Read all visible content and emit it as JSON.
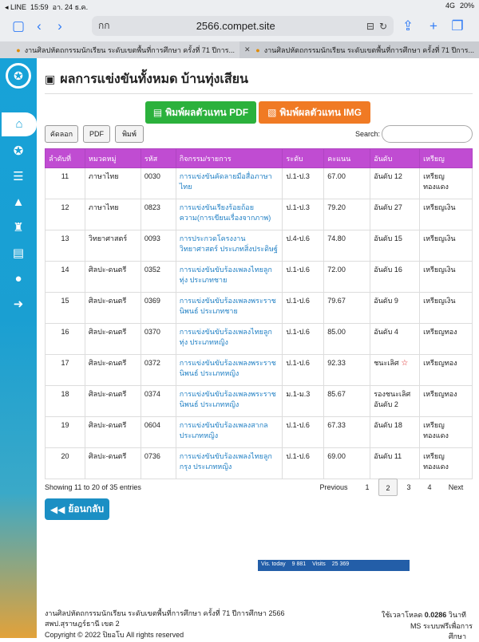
{
  "status": {
    "app": "◂ LINE",
    "time": "15:59",
    "date": "อา. 24 ธ.ค.",
    "net": "4G",
    "battery": "20%"
  },
  "browser": {
    "tabtext": "กก",
    "url": "2566.compet.site",
    "tabs": [
      "งานศิลปหัตถกรรมนักเรียน ระดับเขตพื้นที่การศึกษา ครั้งที่ 71 ปีการ...",
      "งานศิลปหัตถกรรมนักเรียน ระดับเขตพื้นที่การศึกษา ครั้งที่ 71 ปีการ..."
    ]
  },
  "page": {
    "title": "ผลการแข่งขันทั้งหมด บ้านทุ่งเสียน",
    "btn_pdf": "พิมพ์ผลตัวแทน PDF",
    "btn_img": "พิมพ์ผลตัวแทน IMG",
    "btn_copy": "คัดลอก",
    "btn_pdfs": "PDF",
    "btn_print": "พิมพ์",
    "search": "Search:"
  },
  "table": {
    "headers": [
      "ลำดับที่",
      "หมวดหมู่",
      "รหัส",
      "กิจกรรม/รายการ",
      "ระดับ",
      "คะแนน",
      "อันดับ",
      "เหรียญ"
    ],
    "rows": [
      [
        "11",
        "ภาษาไทย",
        "0030",
        "การแข่งขันคัดลายมือสื่อภาษาไทย",
        "ป.1-ป.3",
        "67.00",
        "อันดับ 12",
        "เหรียญทองแดง"
      ],
      [
        "12",
        "ภาษาไทย",
        "0823",
        "การแข่งขันเรียงร้อยถ้อยความ(การเขียนเรื่องจากภาพ)",
        "ป.1-ป.3",
        "79.20",
        "อันดับ 27",
        "เหรียญเงิน"
      ],
      [
        "13",
        "วิทยาศาสตร์",
        "0093",
        "การประกวดโครงงานวิทยาศาสตร์ ประเภทสิ่งประดิษฐ์",
        "ป.4-ป.6",
        "74.80",
        "อันดับ 15",
        "เหรียญเงิน"
      ],
      [
        "14",
        "ศิลปะ-ดนตรี",
        "0352",
        "การแข่งขันขับร้องเพลงไทยลูกทุ่ง ประเภทชาย",
        "ป.1-ป.6",
        "72.00",
        "อันดับ 16",
        "เหรียญเงิน"
      ],
      [
        "15",
        "ศิลปะ-ดนตรี",
        "0369",
        "การแข่งขันขับร้องเพลงพระราชนิพนธ์ ประเภทชาย",
        "ป.1-ป.6",
        "79.67",
        "อันดับ 9",
        "เหรียญเงิน"
      ],
      [
        "16",
        "ศิลปะ-ดนตรี",
        "0370",
        "การแข่งขันขับร้องเพลงไทยลูกทุ่ง ประเภทหญิง",
        "ป.1-ป.6",
        "85.00",
        "อันดับ 4",
        "เหรียญทอง"
      ],
      [
        "17",
        "ศิลปะ-ดนตรี",
        "0372",
        "การแข่งขันขับร้องเพลงพระราชนิพนธ์ ประเภทหญิง",
        "ป.1-ป.6",
        "92.33",
        "ชนะเลิศ",
        "เหรียญทอง"
      ],
      [
        "18",
        "ศิลปะ-ดนตรี",
        "0374",
        "การแข่งขันขับร้องเพลงพระราชนิพนธ์ ประเภทหญิง",
        "ม.1-ม.3",
        "85.67",
        "รองชนะเลิศอันดับ 2",
        "เหรียญทอง"
      ],
      [
        "19",
        "ศิลปะ-ดนตรี",
        "0604",
        "การแข่งขันขับร้องเพลงสากล ประเภทหญิง",
        "ป.1-ป.6",
        "67.33",
        "อันดับ 18",
        "เหรียญทองแดง"
      ],
      [
        "20",
        "ศิลปะ-ดนตรี",
        "0736",
        "การแข่งขันขับร้องเพลงไทยลูกกรุง ประเภทหญิง",
        "ป.1-ป.6",
        "69.00",
        "อันดับ 11",
        "เหรียญทองแดง"
      ]
    ]
  },
  "pager": {
    "info": "Showing 11 to 20 of 35 entries",
    "prev": "Previous",
    "p1": "1",
    "p2": "2",
    "p3": "3",
    "p4": "4",
    "next": "Next"
  },
  "back": "ย้อนกลับ",
  "footer": {
    "line1": "งานศิลปหัตถกรรมนักเรียน ระดับเขตพื้นที่การศึกษา ครั้งที่ 71 ปีการศึกษา 2566",
    "line2": "สพป.สุราษฎร์ธานี เขต 2",
    "line3": "Copyright © 2022 ปิยอโบ All rights reserved",
    "load_label": "ใช้เวลาโหลด",
    "load_val": "0.0286",
    "load_unit": "วินาที",
    "free": "MS ระบบฟรีเพื่อการ",
    "free2": "ศึกษา"
  },
  "counter": {
    "a": "Vis. today",
    "b": "9 881",
    "c": "Visits",
    "d": "25 369"
  }
}
